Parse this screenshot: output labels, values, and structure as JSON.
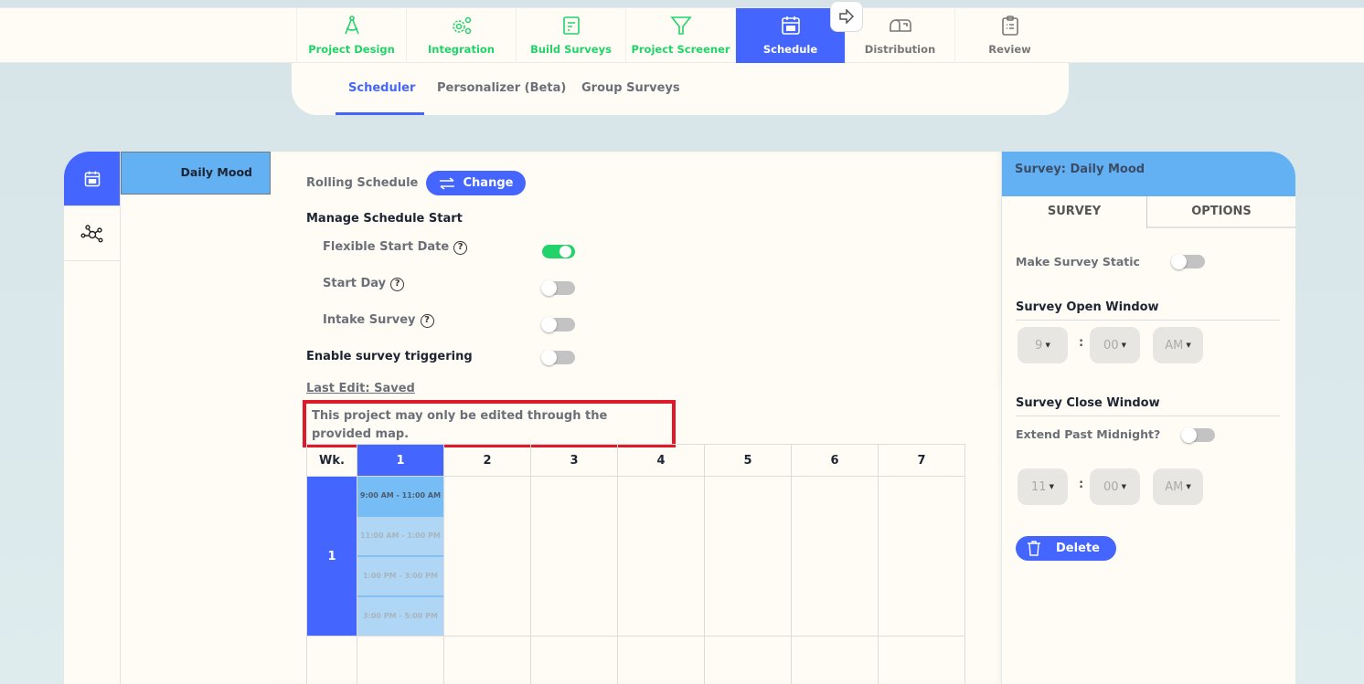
{
  "nav": {
    "items": [
      {
        "label": "Project Design",
        "icon": "compass-icon",
        "state": "green"
      },
      {
        "label": "Integration",
        "icon": "gears-icon",
        "state": "green"
      },
      {
        "label": "Build Surveys",
        "icon": "document-icon",
        "state": "green"
      },
      {
        "label": "Project Screener",
        "icon": "filter-icon",
        "state": "green"
      },
      {
        "label": "Schedule",
        "icon": "calendar-icon",
        "state": "active"
      },
      {
        "label": "Distribution",
        "icon": "mailbox-icon",
        "state": "gray"
      },
      {
        "label": "Review",
        "icon": "clipboard-icon",
        "state": "gray"
      }
    ],
    "next_icon": "arrow-right-icon"
  },
  "subtabs": {
    "items": [
      "Scheduler",
      "Personalizer (Beta)",
      "Group Surveys"
    ],
    "active": "Scheduler"
  },
  "rail": {
    "items": [
      {
        "icon": "calendar-icon",
        "active": true
      },
      {
        "icon": "network-icon",
        "active": false
      }
    ]
  },
  "survey_list": {
    "items": [
      "Daily Mood"
    ],
    "selected": "Daily Mood"
  },
  "main": {
    "schedule_type": "Rolling Schedule",
    "change_label": "Change",
    "manage_start_heading": "Manage Schedule Start",
    "settings": [
      {
        "label": "Flexible Start Date",
        "help": true,
        "on": true
      },
      {
        "label": "Start Day",
        "help": true,
        "on": false
      },
      {
        "label": "Intake Survey",
        "help": true,
        "on": false
      }
    ],
    "triggering_label": "Enable survey triggering",
    "triggering_on": false,
    "last_edit": "Last Edit: Saved",
    "notice": "This project may only be edited through the provided map.",
    "grid": {
      "week_header": "Wk.",
      "days": [
        "1",
        "2",
        "3",
        "4",
        "5",
        "6",
        "7"
      ],
      "active_day": "1",
      "weeks": [
        "1"
      ],
      "slots_day1": [
        {
          "label": "9:00 AM - 11:00 AM",
          "selected": true
        },
        {
          "label": "11:00 AM - 1:00 PM",
          "selected": false
        },
        {
          "label": "1:00 PM - 3:00 PM",
          "selected": false
        },
        {
          "label": "3:00 PM - 5:00 PM",
          "selected": false
        }
      ]
    }
  },
  "right": {
    "title": "Survey: Daily Mood",
    "tabs": [
      "SURVEY",
      "OPTIONS"
    ],
    "active_tab": "SURVEY",
    "static_label": "Make Survey Static",
    "static_on": false,
    "open_heading": "Survey Open Window",
    "open": {
      "hour": "9",
      "minute": "00",
      "ampm": "AM"
    },
    "close_heading": "Survey Close Window",
    "midnight_label": "Extend Past Midnight?",
    "midnight_on": false,
    "close": {
      "hour": "11",
      "minute": "00",
      "ampm": "AM"
    },
    "colon": ":",
    "delete_label": "Delete"
  },
  "colors": {
    "accent": "#4466ff",
    "success": "#22d36a",
    "selected_blue": "#63b1f2",
    "notice_border": "#e0192a"
  }
}
